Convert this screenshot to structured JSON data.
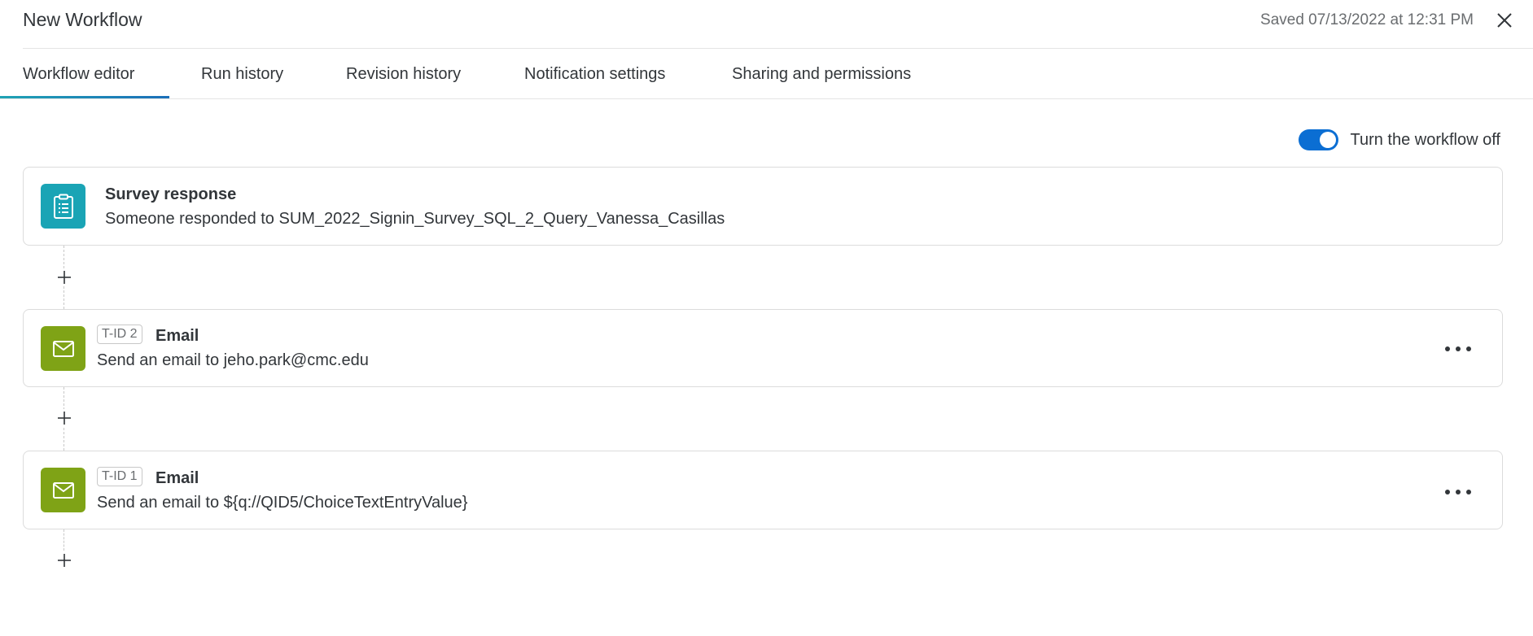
{
  "header": {
    "title": "New Workflow",
    "saved_status": "Saved 07/13/2022 at 12:31 PM"
  },
  "tabs": [
    {
      "label": "Workflow editor",
      "active": true
    },
    {
      "label": "Run history",
      "active": false
    },
    {
      "label": "Revision history",
      "active": false
    },
    {
      "label": "Notification settings",
      "active": false
    },
    {
      "label": "Sharing and permissions",
      "active": false
    }
  ],
  "toggle": {
    "label": "Turn the workflow off",
    "on": true
  },
  "cards": [
    {
      "icon": "clipboard-icon",
      "title": "Survey response",
      "description": "Someone responded to SUM_2022_Signin_Survey_SQL_2_Query_Vanessa_Casillas"
    },
    {
      "icon": "envelope-icon",
      "badge": "T-ID 2",
      "title": "Email",
      "description": "Send an email to jeho.park@cmc.edu"
    },
    {
      "icon": "envelope-icon",
      "badge": "T-ID 1",
      "title": "Email",
      "description": "Send an email to ${q://QID5/ChoiceTextEntryValue}"
    }
  ],
  "colors": {
    "trigger_icon_bg": "#1aa4b5",
    "task_icon_bg": "#7fa316",
    "toggle_on": "#0b6ed3"
  }
}
